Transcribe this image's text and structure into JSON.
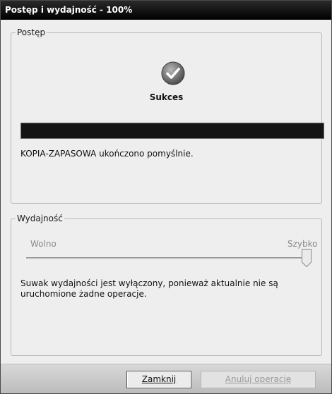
{
  "window": {
    "title": "Postęp i wydajność - 100%"
  },
  "progress_group": {
    "legend": "Postęp",
    "status_icon": "check-icon",
    "result_title": "Sukces",
    "progress_fraction": 1.0,
    "message": "KOPIA-ZAPASOWA ukończono pomyślnie."
  },
  "performance_group": {
    "legend": "Wydajność",
    "slow_label": "Wolno",
    "fast_label": "Szybko",
    "slider_value_fraction": 1.0,
    "description": "Suwak wydajności jest wyłączony, ponieważ aktualnie nie są uruchomione żadne operacje."
  },
  "buttons": {
    "close": "Zamknij",
    "cancel": "Anuluj operację"
  },
  "colors": {
    "title_bar": "#000000",
    "progress_fill": "#141414"
  }
}
